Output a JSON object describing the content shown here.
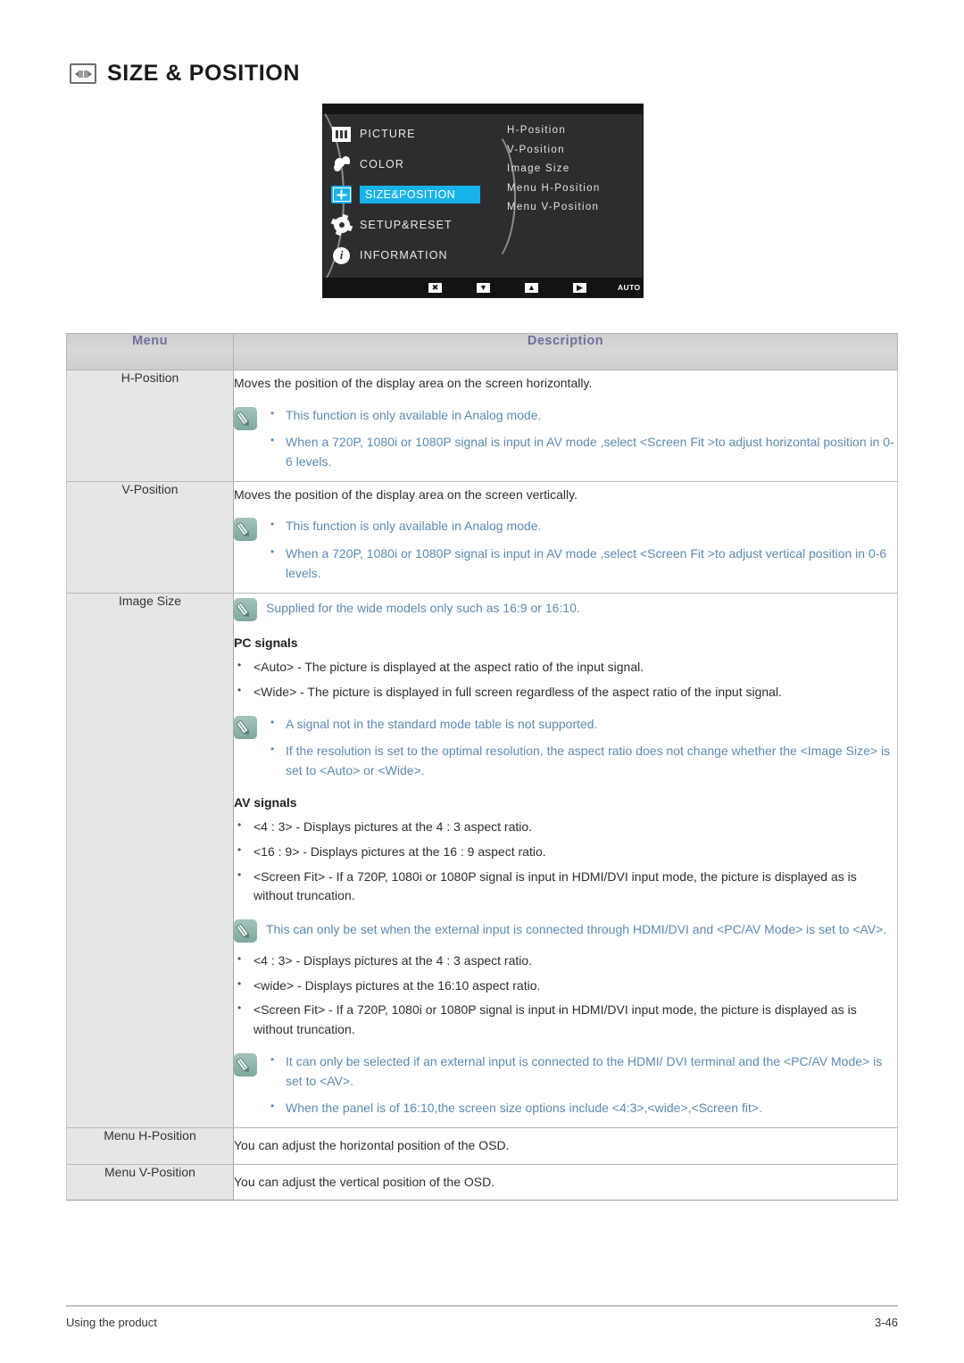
{
  "page": {
    "title": "SIZE & POSITION",
    "title_icon": "size-position-icon"
  },
  "osd": {
    "left_menu": [
      {
        "label": "PICTURE",
        "icon": "picture-icon",
        "selected": false
      },
      {
        "label": "COLOR",
        "icon": "color-icon",
        "selected": false
      },
      {
        "label": "SIZE&POSITION",
        "icon": "size-position-icon",
        "selected": true
      },
      {
        "label": "SETUP&RESET",
        "icon": "gear-icon",
        "selected": false
      },
      {
        "label": "INFORMATION",
        "icon": "info-icon",
        "selected": false
      }
    ],
    "submenu": [
      "H-Position",
      "V-Position",
      "Image Size",
      "Menu H-Position",
      "Menu V-Position"
    ],
    "bottom_buttons": [
      {
        "name": "exit-button",
        "glyph": "✖"
      },
      {
        "name": "down-button",
        "glyph": "▼"
      },
      {
        "name": "up-button",
        "glyph": "▲"
      },
      {
        "name": "enter-button",
        "glyph": "▶"
      },
      {
        "name": "auto-button",
        "glyph": "AUTO"
      },
      {
        "name": "power-button",
        "glyph": "⏻"
      }
    ]
  },
  "table": {
    "headers": {
      "menu": "Menu",
      "description": "Description"
    },
    "rows": {
      "h_position": {
        "menu": "H-Position",
        "lead": "Moves the position of the display area on the screen horizontally.",
        "notes": [
          "This function is only available in Analog mode.",
          "When a 720P, 1080i or 1080P signal is input in AV mode ,select <Screen Fit  >to adjust horizontal position in 0-6 levels."
        ]
      },
      "v_position": {
        "menu": "V-Position",
        "lead": "Moves the position of the display area on the screen vertically.",
        "notes": [
          "This function is only available in Analog mode.",
          "When a 720P, 1080i or 1080P signal is input in AV mode ,select <Screen Fit  >to adjust vertical position in 0-6 levels."
        ]
      },
      "image_size": {
        "menu": "Image Size",
        "note_top": "Supplied for the wide models only such as 16:9 or 16:10.",
        "pc_signals_heading": "PC signals",
        "pc_signals": [
          "<Auto> - The picture is displayed at the aspect ratio of the input signal.",
          "<Wide> - The picture is displayed in full screen regardless of the aspect ratio of the input signal."
        ],
        "pc_notes": [
          "A signal not in the standard mode table is not supported.",
          "If the resolution is set to the optimal resolution, the aspect ratio does not change whether the <Image Size> is set to <Auto> or <Wide>."
        ],
        "av_signals_heading": "AV signals",
        "av_signals_1": [
          "<4 : 3> - Displays pictures at the 4 : 3 aspect ratio.",
          "<16 : 9> - Displays pictures at the 16 : 9 aspect ratio.",
          "<Screen Fit> - If a 720P, 1080i or 1080P signal is input in HDMI/DVI input mode, the picture is displayed as is without truncation."
        ],
        "av_note_1": "This can only be set when the external input is connected through HDMI/DVI and <PC/AV Mode> is set to <AV>.",
        "av_signals_2": [
          "<4 : 3> - Displays pictures at the 4 : 3 aspect ratio.",
          "<wide> - Displays pictures at the 16:10 aspect ratio.",
          "<Screen Fit> - If a 720P, 1080i or 1080P signal is input in HDMI/DVI input mode, the picture is displayed as is without truncation."
        ],
        "av_notes_2": [
          "It can only be selected if an external input is connected to the HDMI/ DVI terminal and the <PC/AV Mode> is set to <AV>.",
          "When the panel is of 16:10,the screen size options include <4:3>,<wide>,<Screen fit>."
        ]
      },
      "menu_h_position": {
        "menu": "Menu H-Position",
        "lead": "You can adjust the horizontal position of the OSD."
      },
      "menu_v_position": {
        "menu": "Menu V-Position",
        "lead": "You can adjust the vertical position of the OSD."
      }
    }
  },
  "footer": {
    "left": "Using the product",
    "right": "3-46"
  },
  "colors": {
    "header_text": "#6f6f9c",
    "note_text": "#5b8ab3",
    "note_icon_bg": "#8fb4ab",
    "osd_highlight": "#17b2e8",
    "menu_cell_bg": "#e6e6e6"
  }
}
